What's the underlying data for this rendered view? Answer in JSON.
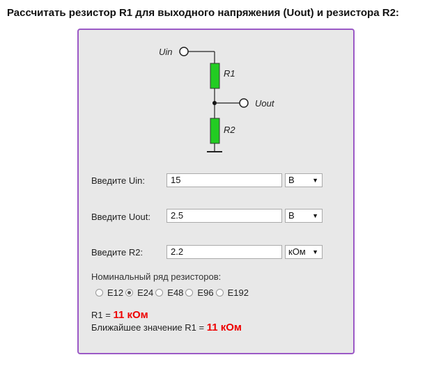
{
  "heading": "Рассчитать резистор R1 для выходного напряжения (Uout) и резистора R2:",
  "circuit": {
    "uin_label": "Uin",
    "r1_label": "R1",
    "uout_label": "Uout",
    "r2_label": "R2"
  },
  "form": {
    "uin": {
      "label": "Введите Uin:",
      "value": "15",
      "unit": "В"
    },
    "uout": {
      "label": "Введите Uout:",
      "value": "2.5",
      "unit": "В"
    },
    "r2": {
      "label": "Введите R2:",
      "value": "2.2",
      "unit": "кОм"
    }
  },
  "series": {
    "label": "Номинальный ряд резисторов:",
    "options": [
      "E12",
      "E24",
      "E48",
      "E96",
      "E192"
    ],
    "selected": "E24"
  },
  "result": {
    "r1_prefix": "R1 = ",
    "r1_value": "11 кОм",
    "nearest_prefix": "Ближайшее значение R1 = ",
    "nearest_value": "11 кОм"
  },
  "colors": {
    "resistor": "#22cc22",
    "panel_border": "#9b59c6",
    "result": "#ee0000"
  }
}
